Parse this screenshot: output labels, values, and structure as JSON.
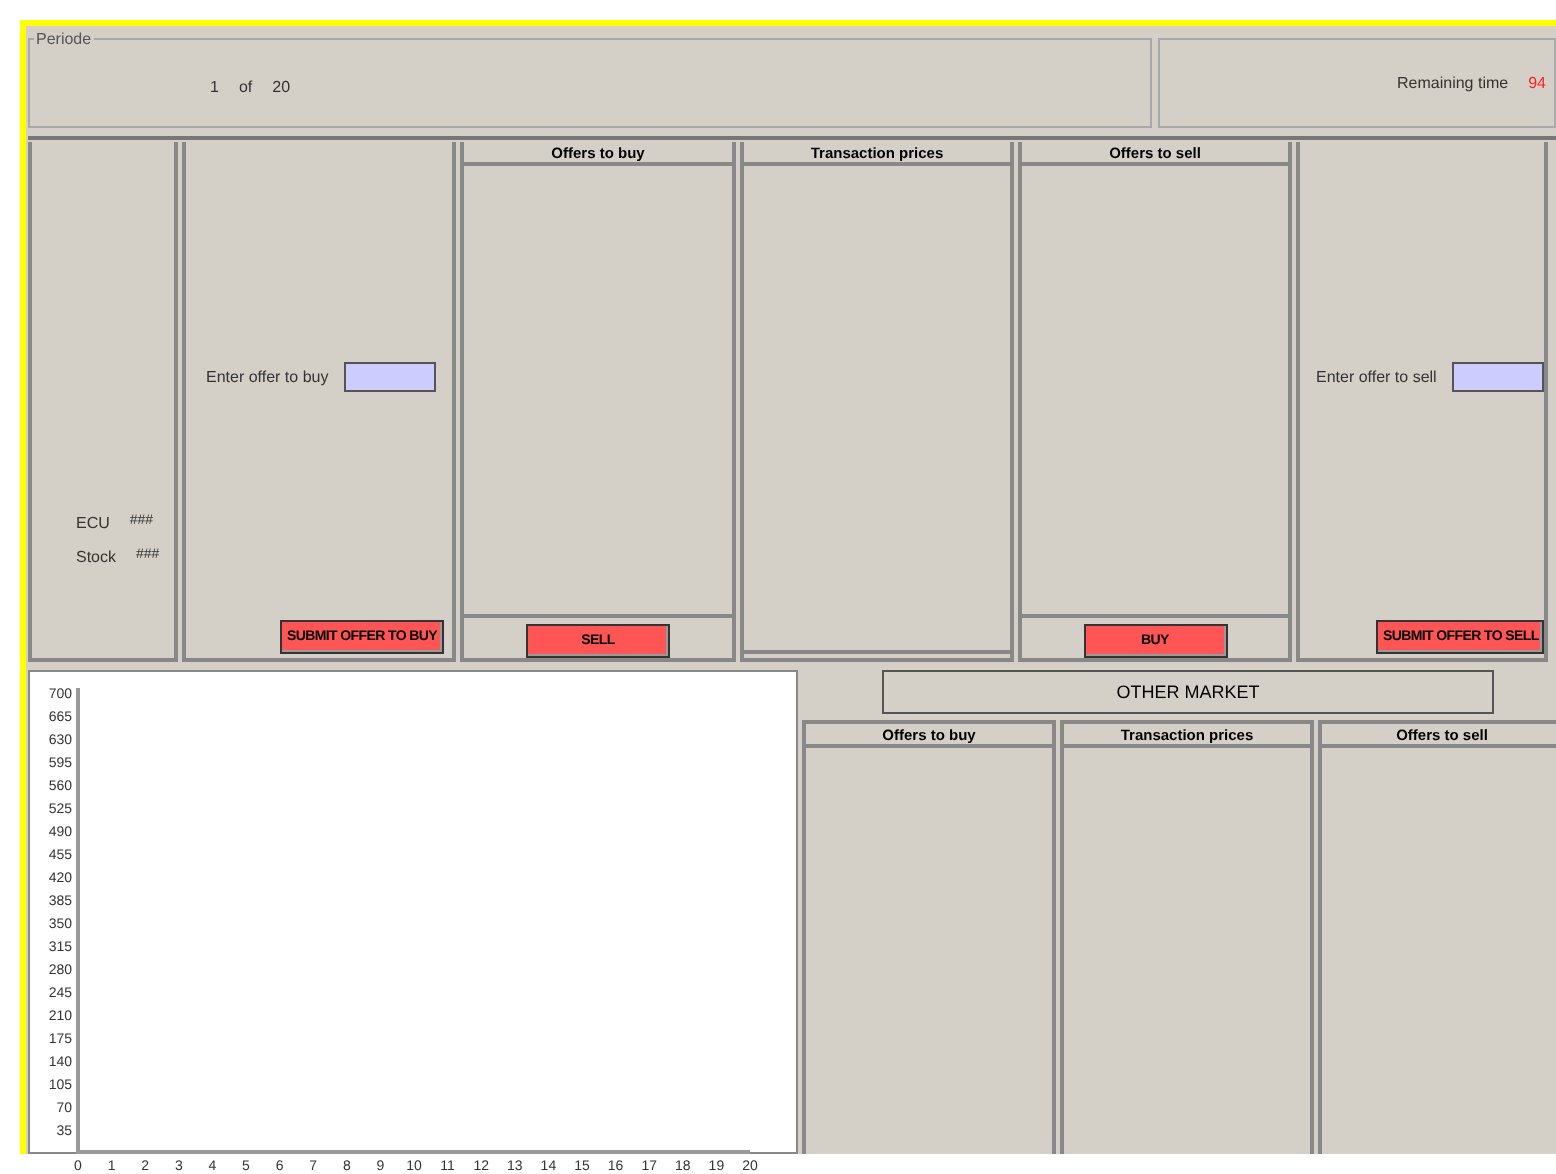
{
  "period": {
    "legend": "Periode",
    "current": "1",
    "separator": "of",
    "total": "20"
  },
  "remaining": {
    "label": "Remaining time",
    "value": "94"
  },
  "account": [
    {
      "label": "ECU",
      "value": "###"
    },
    {
      "label": "Stock",
      "value": "###"
    }
  ],
  "buy_entry": {
    "label": "Enter offer to buy",
    "button": "SUBMIT OFFER TO BUY"
  },
  "market": [
    {
      "title": "Offers to buy",
      "button": "SELL"
    },
    {
      "title": "Transaction prices"
    },
    {
      "title": "Offers to sell",
      "button": "BUY"
    }
  ],
  "sell_entry": {
    "label": "Enter offer to sell",
    "button": "SUBMIT OFFER TO SELL"
  },
  "chart": {
    "chart_data": {
      "type": "line",
      "xlim": [
        0,
        20
      ],
      "ylim": [
        0,
        700
      ],
      "xticks": [
        0,
        1,
        2,
        3,
        4,
        5,
        6,
        7,
        8,
        9,
        10,
        11,
        12,
        13,
        14,
        15,
        16,
        17,
        18,
        19,
        20
      ],
      "yticks": [
        35,
        70,
        105,
        140,
        175,
        210,
        245,
        280,
        315,
        350,
        385,
        420,
        455,
        490,
        525,
        560,
        595,
        630,
        665,
        700
      ]
    }
  },
  "other_market": {
    "title": "OTHER MARKET",
    "columns": [
      "Offers to buy",
      "Transaction prices",
      "Offers to sell"
    ]
  }
}
